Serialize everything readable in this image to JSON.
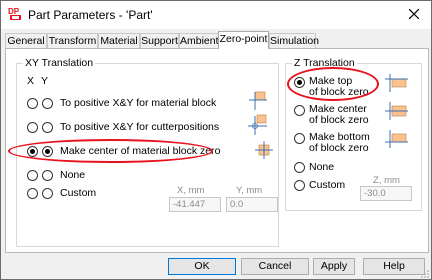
{
  "window": {
    "title": "Part Parameters - 'Part'",
    "app_icon": "dp-logo-icon",
    "close_icon": "close-icon"
  },
  "tabs": [
    {
      "label": "General",
      "active": false
    },
    {
      "label": "Transform",
      "active": false
    },
    {
      "label": "Material",
      "active": false
    },
    {
      "label": "Support",
      "active": false
    },
    {
      "label": "Ambient",
      "active": false
    },
    {
      "label": "Zero-point",
      "active": true
    },
    {
      "label": "Simulation",
      "active": false
    }
  ],
  "xy_group": {
    "title": "XY Translation",
    "col_x": "X",
    "col_y": "Y",
    "options": [
      {
        "label": "To positive X&Y for material block",
        "checked_x": false,
        "checked_y": false,
        "icon": "corner-block-icon"
      },
      {
        "label": "To positive X&Y for cutterpositions",
        "checked_x": false,
        "checked_y": false,
        "icon": "corner-cutter-icon"
      },
      {
        "label": "Make center of material block zero",
        "checked_x": true,
        "checked_y": true,
        "icon": "center-block-icon"
      },
      {
        "label": "None",
        "checked_x": false,
        "checked_y": false
      },
      {
        "label": "Custom",
        "checked_x": false,
        "checked_y": false
      }
    ],
    "x_label": "X, mm",
    "y_label": "Y, mm",
    "x_value": "-41.447",
    "y_value": "0.0"
  },
  "z_group": {
    "title": "Z Translation",
    "options": [
      {
        "line1": "Make top",
        "line2": "of block zero",
        "checked": true,
        "icon": "block-top-icon"
      },
      {
        "line1": "Make center",
        "line2": "of block zero",
        "checked": false,
        "icon": "block-center-icon"
      },
      {
        "line1": "Make bottom",
        "line2": "of block zero",
        "checked": false,
        "icon": "block-bottom-icon"
      },
      {
        "line1": "None",
        "checked": false
      },
      {
        "line1": "Custom",
        "checked": false
      }
    ],
    "z_label": "Z, mm",
    "z_value": "-30.0"
  },
  "buttons": {
    "ok": "OK",
    "cancel": "Cancel",
    "apply": "Apply",
    "help": "Help"
  },
  "colors": {
    "highlight": "#e8121e",
    "block_fill": "#f9c28f",
    "focus_border": "#0078d7"
  }
}
